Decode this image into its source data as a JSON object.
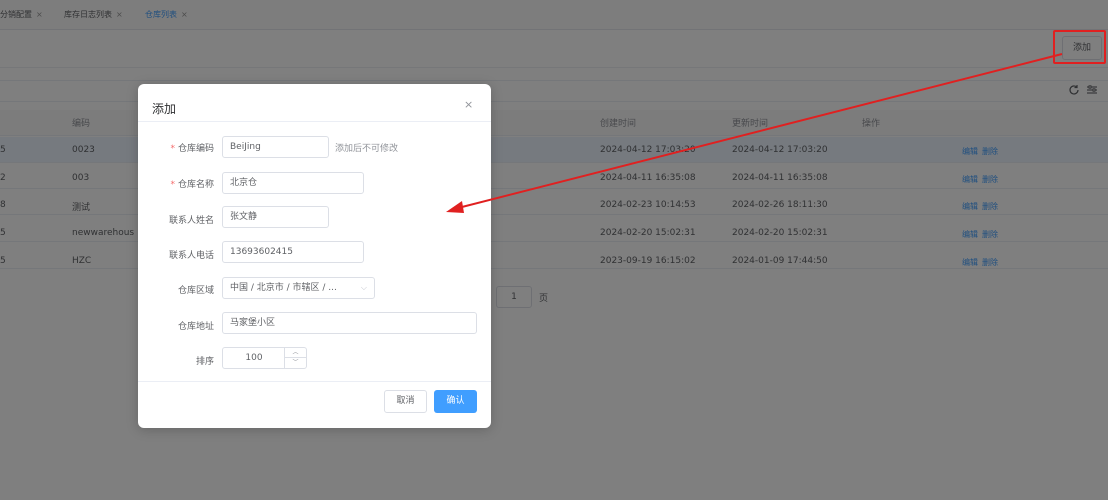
{
  "tabs": [
    {
      "label": "分销配置",
      "close": "×"
    },
    {
      "label": "库存日志列表",
      "close": "×"
    },
    {
      "label": "仓库列表",
      "close": "×"
    }
  ],
  "toolbar": {
    "add_label": "添加"
  },
  "table": {
    "headers": {
      "code": "编码",
      "created": "创建时间",
      "updated": "更新时间",
      "actions": "操作"
    },
    "rows": [
      {
        "id": "5",
        "code": "0023",
        "created": "2024-04-12 17:03:20",
        "updated": "2024-04-12 17:03:20",
        "edit": "编辑",
        "delete": "删除"
      },
      {
        "id": "2",
        "code": "003",
        "created": "2024-04-11 16:35:08",
        "updated": "2024-04-11 16:35:08",
        "edit": "编辑",
        "delete": "删除"
      },
      {
        "id": "8",
        "code": "测试",
        "created": "2024-02-23 10:14:53",
        "updated": "2024-02-26 18:11:30",
        "edit": "编辑",
        "delete": "删除"
      },
      {
        "id": "5",
        "code": "newwarehous",
        "created": "2024-02-20 15:02:31",
        "updated": "2024-02-20 15:02:31",
        "edit": "编辑",
        "delete": "删除"
      },
      {
        "id": "5",
        "code": "HZC",
        "created": "2023-09-19 16:15:02",
        "updated": "2024-01-09 17:44:50",
        "edit": "编辑",
        "delete": "删除"
      }
    ]
  },
  "pager": {
    "page": "1",
    "suffix": "页"
  },
  "dialog": {
    "title": "添加",
    "close": "×",
    "fields": {
      "code": {
        "label": "仓库编码",
        "value": "BeiJing",
        "hint": "添加后不可修改"
      },
      "name": {
        "label": "仓库名称",
        "value": "北京仓"
      },
      "contact": {
        "label": "联系人姓名",
        "value": "张文静"
      },
      "phone": {
        "label": "联系人电话",
        "value": "13693602415"
      },
      "region": {
        "label": "仓库区域",
        "value": "中国 / 北京市 / 市辖区 / ..."
      },
      "address": {
        "label": "仓库地址",
        "value": "马家堡小区"
      },
      "sort": {
        "label": "排序",
        "value": "100"
      }
    },
    "cancel_label": "取消",
    "confirm_label": "确认"
  },
  "colors": {
    "primary": "#409eff",
    "annotation": "#e02020",
    "required": "#f56c6c"
  }
}
